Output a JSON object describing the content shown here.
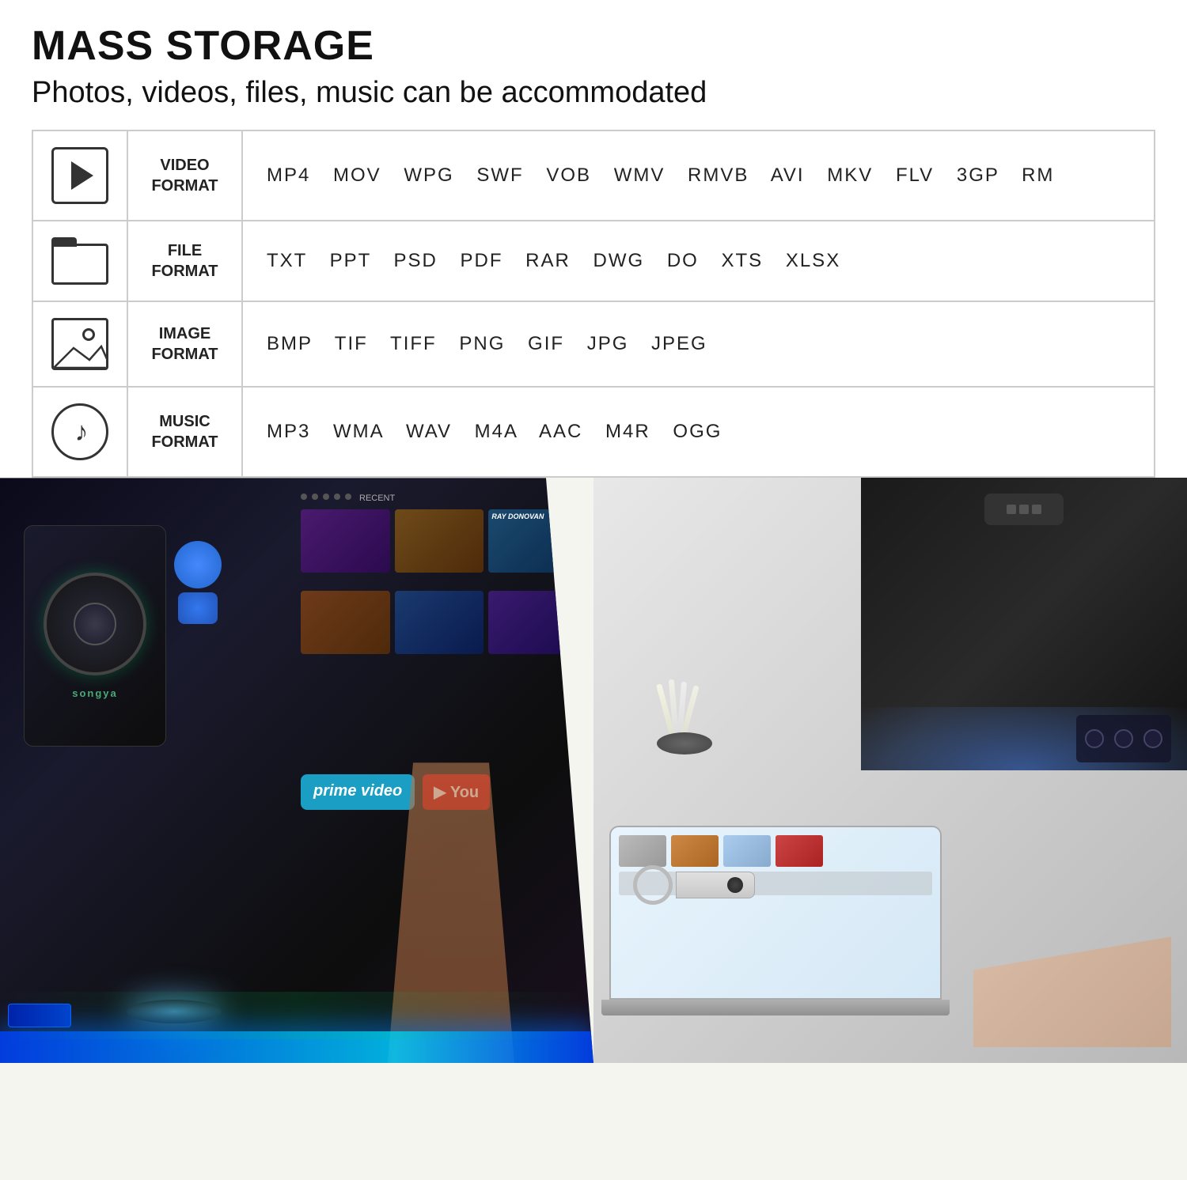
{
  "page": {
    "title": "MASS STORAGE",
    "subtitle": "Photos, videos, files, music can be accommodated"
  },
  "formats": [
    {
      "id": "video",
      "icon": "video-icon",
      "label": "VIDEO\nFORMAT",
      "label_line1": "VIDEO",
      "label_line2": "FORMAT",
      "values": "MP4   MOV   WPG   SWF   VOB   WMV   RMVB   AVI   MKV   FLV   3GP   RM"
    },
    {
      "id": "file",
      "icon": "folder-icon",
      "label": "FILE\nFORMAT",
      "label_line1": "FILE",
      "label_line2": "FORMAT",
      "values": "TXT   PPT   PSD   PDF   RAR   DWG   DO   XTS   XLSX"
    },
    {
      "id": "image",
      "icon": "image-icon",
      "label": "IMAGE\nFORMAT",
      "label_line1": "IMAGE",
      "label_line2": "FORMAT",
      "values": "BMP   TIF   TIFF   PNG   GIF   JPG   JPEG"
    },
    {
      "id": "music",
      "icon": "music-icon",
      "label": "MUSIC\nFORMAT",
      "label_line1": "MUSIC",
      "label_line2": "FORMAT",
      "values": "MP3   WMA   WAV   M4A   AAC   M4R   OGG"
    }
  ],
  "bottom": {
    "left_scene": "smart home speaker with TV streaming interface",
    "right_scene": "USB drive with laptop and car interior"
  }
}
